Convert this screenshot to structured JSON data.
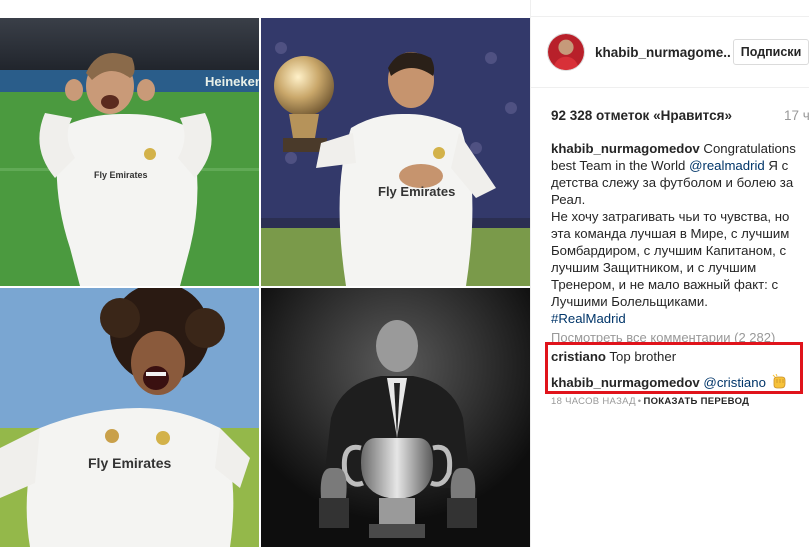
{
  "post": {
    "username": "khabib_nurmagome..",
    "follow_label": "Подписки",
    "likes": "92 328 отметок «Нравится»",
    "time_ago_short": "17 ч",
    "caption": {
      "username": "khabib_nurmagomedov",
      "text_before_mention": " Congratulations best Team in the World ",
      "mention": "@realmadrid",
      "text_after_mention": " Я с детства слежу за футболом и болею за Реал.",
      "paragraph": "Не хочу затрагивать чьи то чувства, но эта команда лучшая в Мире, с лучшим Бомбардиром, с лучшим Капитаном, с лучшим Защитником, и с лучшим Тренером, и не мало важный факт: с Лучшими Болельщиками.",
      "hashtag": "#RealMadrid"
    },
    "view_all_comments": "Посмотреть все комментарии (2 282)",
    "comments": [
      {
        "username": "cristiano",
        "text": " Top brother"
      },
      {
        "username": "khabib_nurmagomedov",
        "mention": " @cristiano",
        "emoji": "fist-bump-emoji"
      }
    ],
    "comment_meta": {
      "time_ago": "18 ЧАСОВ НАЗАД",
      "dot": "•",
      "translate_label": "ПОКАЗАТЬ ПЕРЕВОД"
    }
  },
  "photos": {
    "shirt_sponsor": "Fly Emirates",
    "ad_board": "Heineken"
  },
  "colors": {
    "highlight_border": "#e0131b",
    "link": "#003569",
    "muted": "#999999",
    "text": "#262626"
  }
}
